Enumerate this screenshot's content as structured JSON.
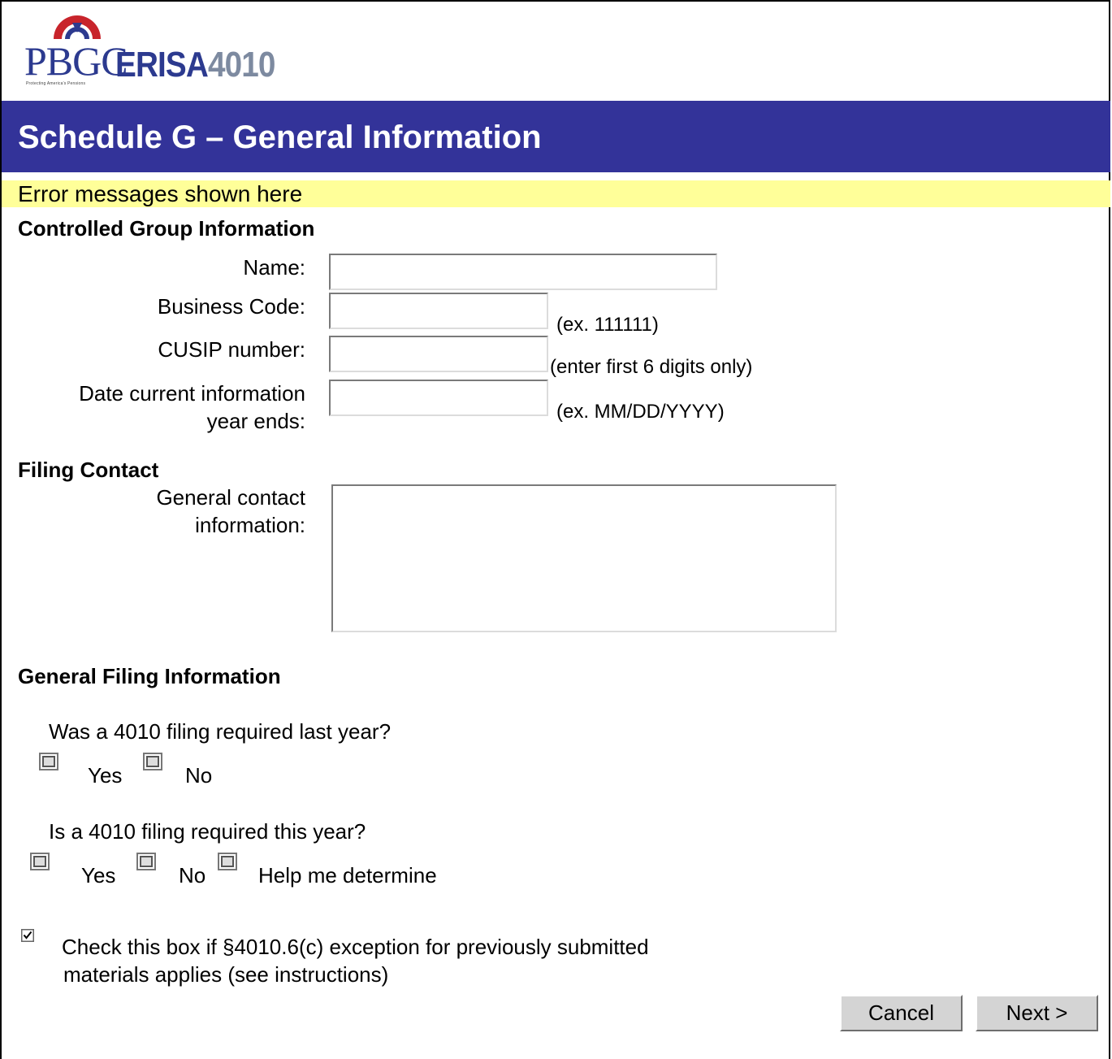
{
  "logo": {
    "brand": "PBGC",
    "product_word": "ERISA",
    "product_number": "4010",
    "tagline": "Protecting America's Pensions"
  },
  "header": {
    "title": "Schedule G – General Information"
  },
  "error_bar": {
    "text": "Error messages shown here"
  },
  "controlled_group": {
    "heading": "Controlled Group Information",
    "name_label": "Name:",
    "business_code_label": "Business Code:",
    "business_code_hint": "(ex. 111111)",
    "cusip_label": "CUSIP number:",
    "cusip_hint": "(enter first 6 digits only)",
    "date_label_line1": "Date current information",
    "date_label_line2": "year ends:",
    "date_hint": "(ex. MM/DD/YYYY)"
  },
  "filing_contact": {
    "heading": "Filing Contact",
    "label_line1": "General contact",
    "label_line2": "information:"
  },
  "general_filing": {
    "heading": "General Filing Information",
    "q1": "Was a 4010 filing required last year?",
    "q1_yes": "Yes",
    "q1_no": "No",
    "q2": "Is a 4010 filing required this year?",
    "q2_yes": "Yes",
    "q2_no": "No",
    "q2_help": "Help me determine",
    "exception_line1": "Check this box if §4010.6(c) exception for previously submitted",
    "exception_line2": "materials applies (see instructions)",
    "exception_checked": true
  },
  "buttons": {
    "cancel": "Cancel",
    "next": "Next >"
  },
  "colors": {
    "title_bar": "#333399",
    "error_bar": "#ffff99",
    "logo_blue": "#2c3a8f"
  }
}
